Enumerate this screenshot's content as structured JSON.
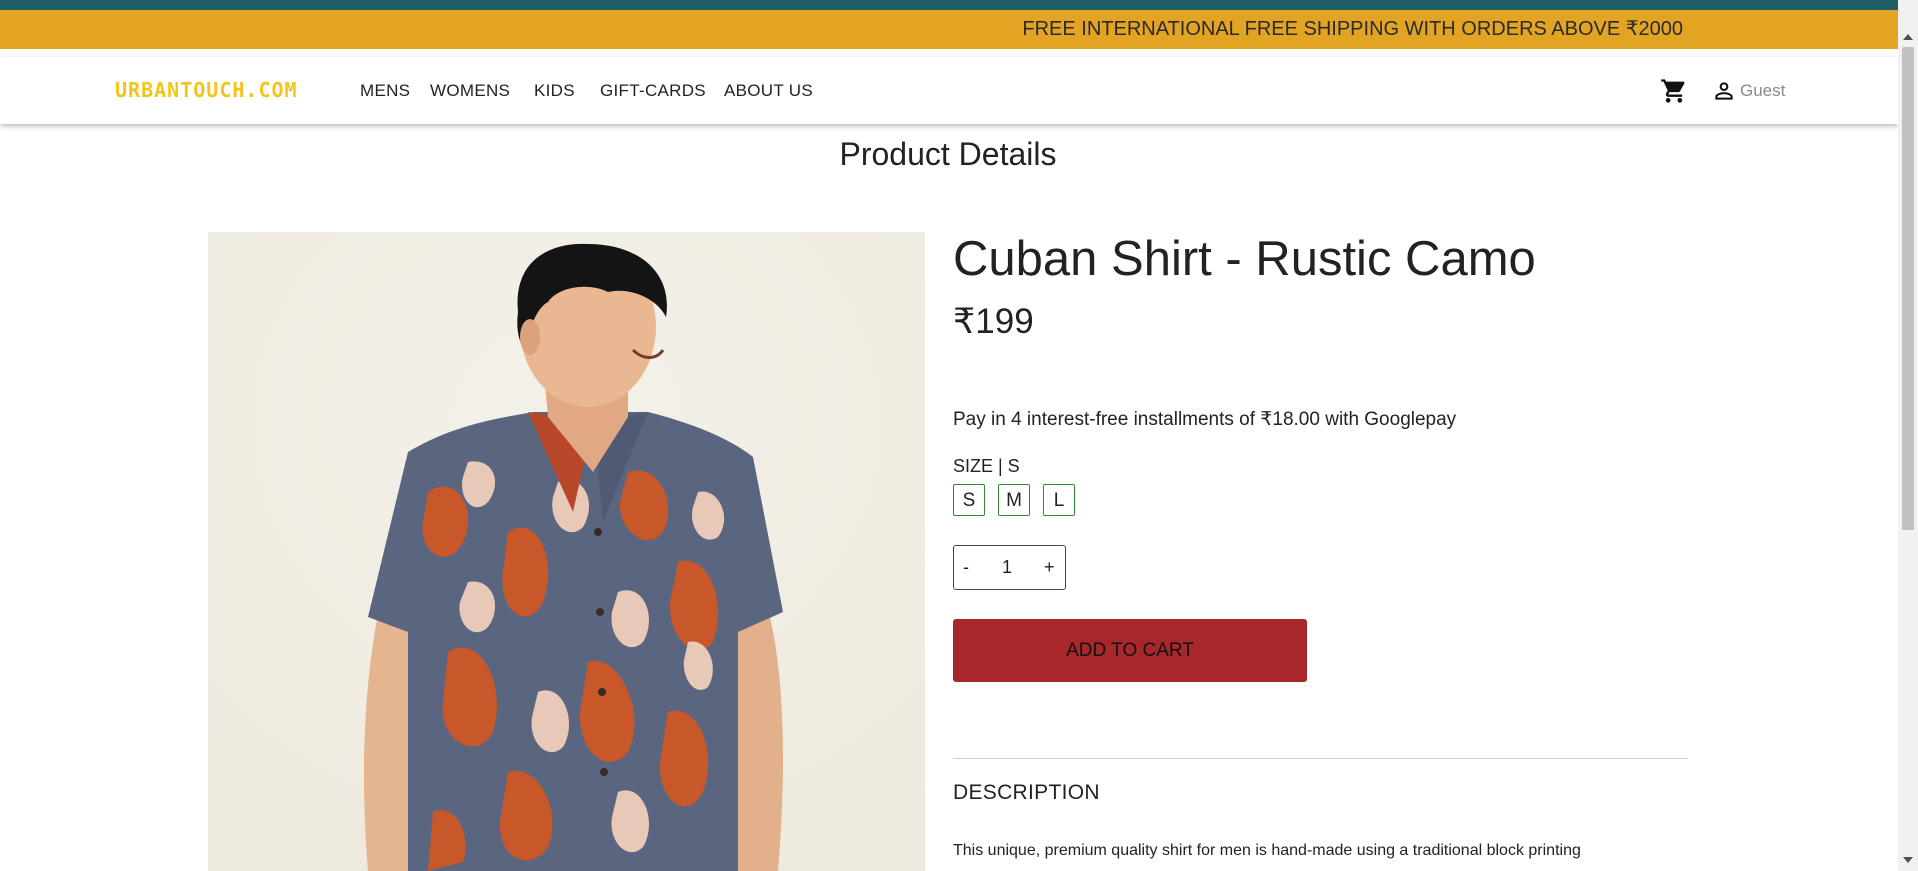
{
  "announcement": "FREE INTERNATIONAL FREE SHIPPING WITH ORDERS ABOVE ₹2000",
  "brand": {
    "logo": "URBANTOUCH.COM",
    "logo_color": "#f4c518",
    "accent": "#e3a424",
    "top_strip": "#1f5f63"
  },
  "nav": {
    "links": [
      "MENS",
      "WOMENS",
      "KIDS",
      "GIFT-CARDS",
      "ABOUT US"
    ],
    "cart_icon": "shopping-cart-icon",
    "user_icon": "user-icon",
    "user_label": "Guest"
  },
  "page_title": "Product Details",
  "product": {
    "name": "Cuban Shirt - Rustic Camo",
    "price": "₹199",
    "installments": "Pay in 4 interest-free installments of ₹18.00 with Googlepay",
    "size_label": "SIZE | S",
    "sizes": [
      "S",
      "M",
      "L"
    ],
    "selected_size": "S",
    "quantity": {
      "minus": "-",
      "value": "1",
      "plus": "+"
    },
    "add_to_cart": "ADD TO CART",
    "add_to_cart_color": "#a8272b",
    "description_heading": "DESCRIPTION",
    "description": "This unique, premium quality shirt for men is hand-made using a traditional block printing"
  }
}
